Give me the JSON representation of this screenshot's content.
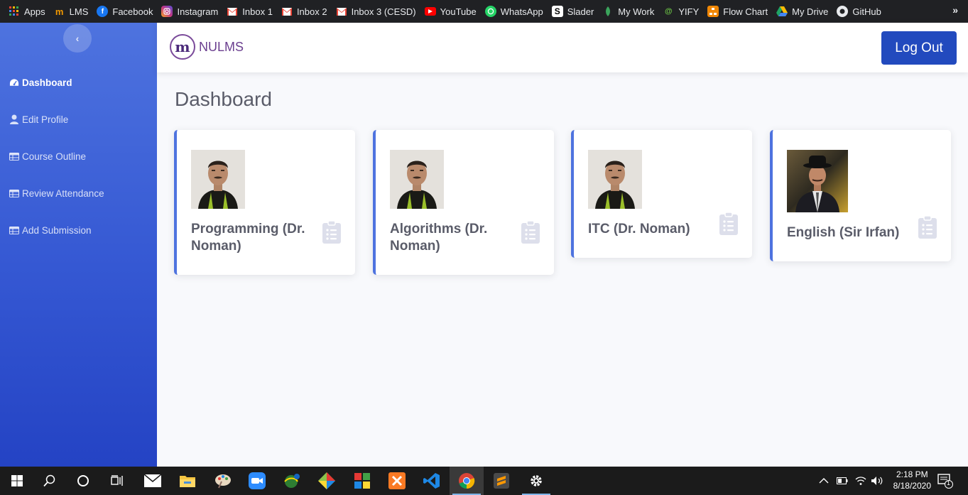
{
  "bookmarks": [
    {
      "label": "Apps",
      "icon": "apps-grid-icon",
      "color": "#ea4335"
    },
    {
      "label": "LMS",
      "icon": "lms-icon",
      "color": "#f29900"
    },
    {
      "label": "Facebook",
      "icon": "facebook-icon",
      "color": "#1877f2"
    },
    {
      "label": "Instagram",
      "icon": "instagram-icon",
      "color": "#c13584"
    },
    {
      "label": "Inbox 1",
      "icon": "gmail-icon",
      "color": "#ea4335"
    },
    {
      "label": "Inbox 2",
      "icon": "gmail-icon",
      "color": "#ea4335"
    },
    {
      "label": "Inbox 3 (CESD)",
      "icon": "gmail-icon",
      "color": "#ea4335"
    },
    {
      "label": "YouTube",
      "icon": "youtube-icon",
      "color": "#ff0000"
    },
    {
      "label": "WhatsApp",
      "icon": "whatsapp-icon",
      "color": "#25d366"
    },
    {
      "label": "Slader",
      "icon": "slader-icon",
      "color": "#000000"
    },
    {
      "label": "My Work",
      "icon": "my-work-icon",
      "color": "#3ba55c"
    },
    {
      "label": "YIFY",
      "icon": "yify-icon",
      "color": "#6ac045"
    },
    {
      "label": "Flow Chart",
      "icon": "flow-chart-icon",
      "color": "#f08705"
    },
    {
      "label": "My Drive",
      "icon": "google-drive-icon",
      "color": "#1fa463"
    },
    {
      "label": "GitHub",
      "icon": "github-icon",
      "color": "#ffffff"
    }
  ],
  "bookmarks_overflow": "»",
  "sidebar": {
    "toggle_icon": "‹",
    "items": [
      {
        "label": "Dashboard",
        "icon": "tachometer-icon",
        "active": true
      },
      {
        "label": "Edit Profile",
        "icon": "user-icon",
        "active": false
      },
      {
        "label": "Course Outline",
        "icon": "table-icon",
        "active": false
      },
      {
        "label": "Review Attendance",
        "icon": "table-icon",
        "active": false
      },
      {
        "label": "Add Submission",
        "icon": "table-icon",
        "active": false
      }
    ]
  },
  "topbar": {
    "brand_logo_text": "m",
    "brand_name": "NULMS",
    "logout_label": "Log Out"
  },
  "page_title": "Dashboard",
  "courses": [
    {
      "title": "Programming (Dr. Noman)",
      "teacher_photo": "teacher-photo-dr-noman"
    },
    {
      "title": "Algorithms (Dr. Noman)",
      "teacher_photo": "teacher-photo-dr-noman"
    },
    {
      "title": "ITC (Dr. Noman)",
      "teacher_photo": "teacher-photo-dr-noman"
    },
    {
      "title": "English (Sir Irfan)",
      "teacher_photo": "teacher-photo-sir-irfan"
    }
  ],
  "colors": {
    "accent": "#4e73df",
    "logout": "#224abe",
    "card_icon": "#dddfeb",
    "title_text": "#5a5c69"
  },
  "taskbar": {
    "apps": [
      "windows-start-icon",
      "search-icon",
      "cortana-icon",
      "task-view-icon",
      "mail-icon",
      "file-explorer-icon",
      "paint-icon",
      "zoom-icon",
      "internet-icon",
      "git-icon",
      "office-icon",
      "xampp-icon",
      "vscode-icon",
      "chrome-icon",
      "sublime-text-icon",
      "settings-icon"
    ],
    "time": "2:18 PM",
    "date": "8/18/2020",
    "notification_count": "1"
  }
}
